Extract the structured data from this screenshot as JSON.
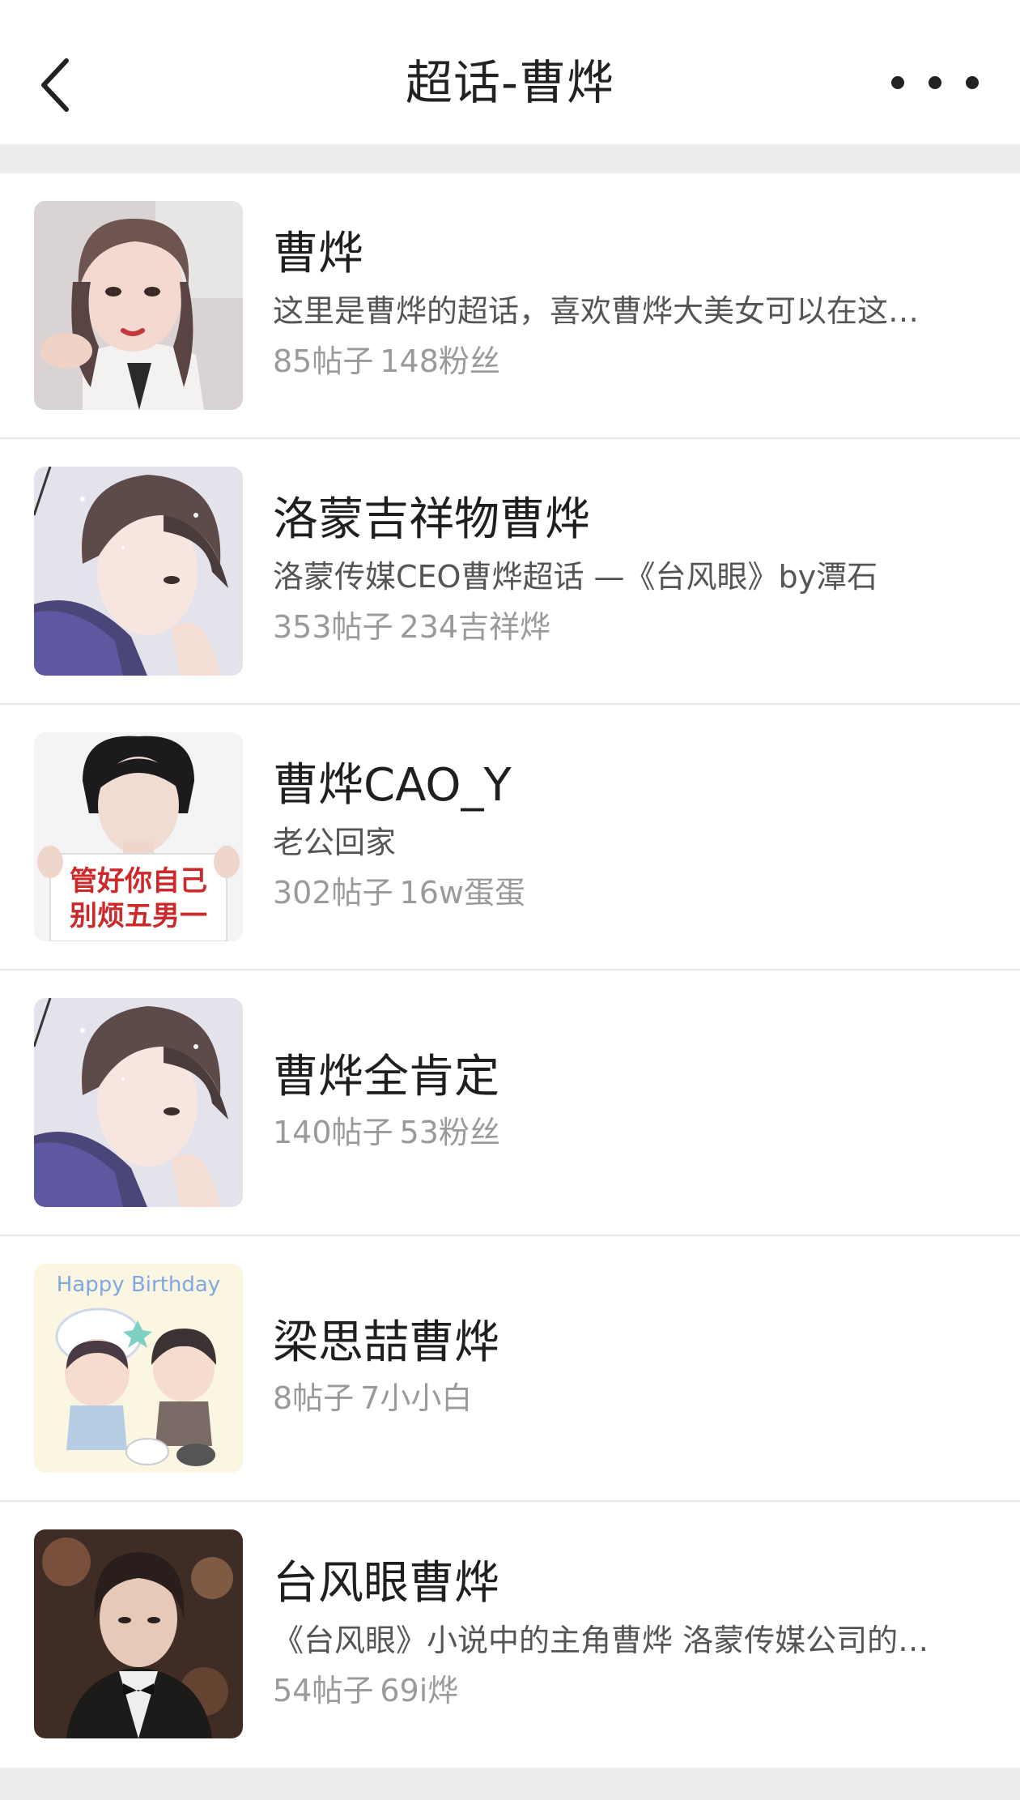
{
  "header": {
    "title": "超话-曹烨",
    "back_icon": "chevron-left-icon",
    "more_icon": "ellipsis-icon"
  },
  "colors": {
    "background": "#ececec",
    "card": "#ffffff",
    "title_text": "#222222",
    "secondary_text": "#555555",
    "meta_text": "#9a9a9a",
    "divider": "#e6e6e6"
  },
  "topics": [
    {
      "title": "曹烨",
      "description": "这里是曹烨的超话，喜欢曹烨大美女可以在这…",
      "posts": "85帖子",
      "followers": "148粉丝"
    },
    {
      "title": "洛蒙吉祥物曹烨",
      "description": "洛蒙传媒CEO曹烨超话  —《台风眼》by潭石",
      "posts": "353帖子",
      "followers": "234吉祥烨"
    },
    {
      "title": "曹烨CAO_Y",
      "description": "老公回家",
      "posts": "302帖子",
      "followers": "16w蛋蛋",
      "image_text": [
        "管好你自己",
        "别烦五男一"
      ]
    },
    {
      "title": "曹烨全肯定",
      "description": "",
      "posts": "140帖子",
      "followers": "53粉丝"
    },
    {
      "title": "梁思喆曹烨",
      "description": "",
      "posts": "8帖子",
      "followers": "7小小白",
      "image_text": [
        "Happy Birthday"
      ]
    },
    {
      "title": "台风眼曹烨",
      "description": "《台风眼》小说中的主角曹烨 洛蒙传媒公司的…",
      "posts": "54帖子",
      "followers": "69i烨"
    }
  ]
}
